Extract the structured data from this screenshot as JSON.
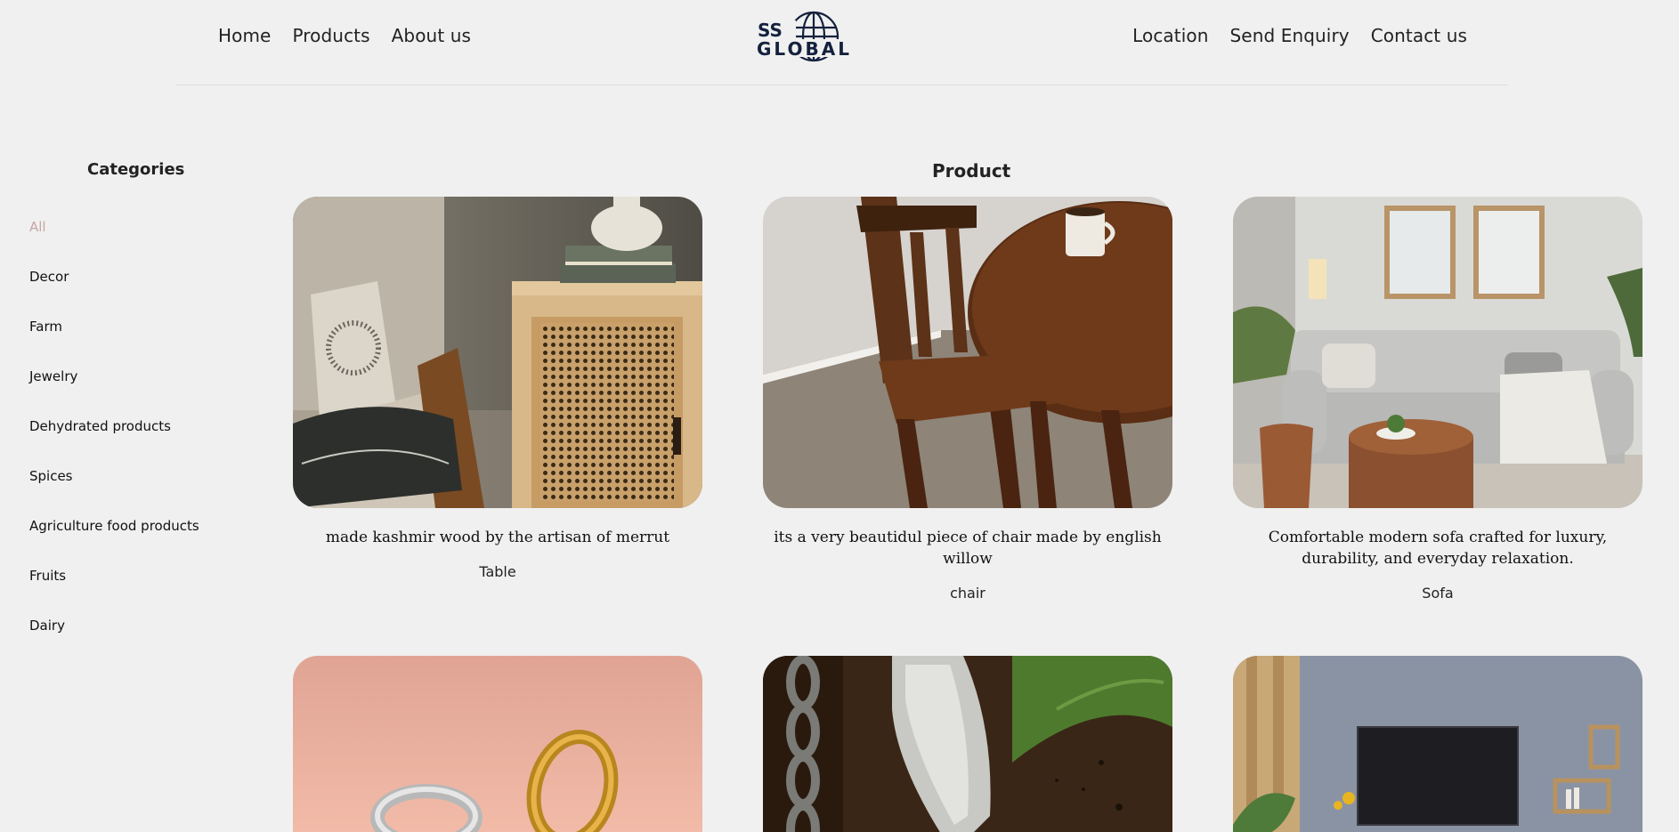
{
  "nav": {
    "left": [
      "Home",
      "Products",
      "About us"
    ],
    "right": [
      "Location",
      "Send Enquiry",
      "Contact us"
    ],
    "logo_text": [
      "SS",
      "GLOBAL"
    ]
  },
  "sidebar": {
    "title": "Categories",
    "items": [
      "All",
      "Decor",
      "Farm",
      "Jewelry",
      "Dehydrated products",
      "Spices",
      "Agriculture food products",
      "Fruits",
      "Dairy"
    ],
    "active_color": "#c9a5a5"
  },
  "main": {
    "heading": "Product",
    "products": [
      {
        "description": "made kashmir wood by the artisan of merrut",
        "name": "Table"
      },
      {
        "description": "its a very beautidul piece of chair made by english willow",
        "name": "chair"
      },
      {
        "description": "Comfortable modern sofa crafted for luxury, durability, and everyday relaxation.",
        "name": "Sofa"
      }
    ]
  },
  "colors": {
    "background": "#f0f0f0",
    "text": "#222222"
  }
}
